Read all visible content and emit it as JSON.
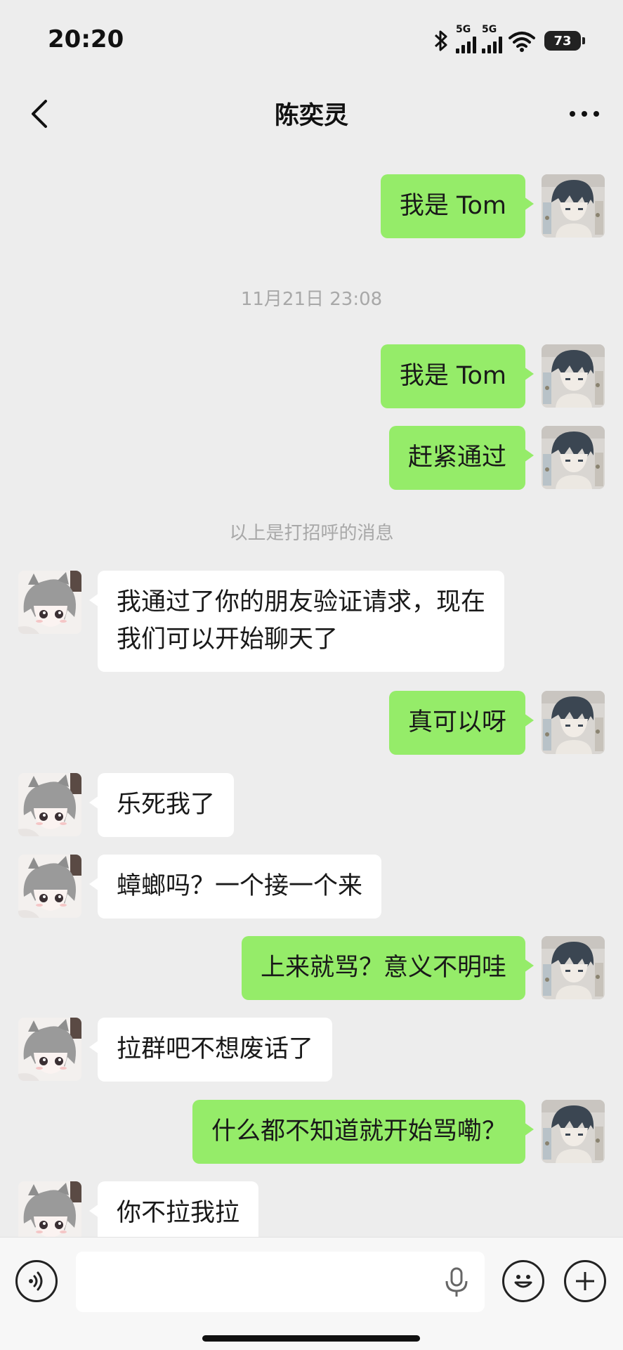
{
  "status_bar": {
    "time": "20:20",
    "net1": "5G",
    "net2": "5G",
    "battery": "73"
  },
  "nav": {
    "title": "陈奕灵"
  },
  "system": {
    "timestamp": "11月21日 23:08",
    "greeting_note": "以上是打招呼的消息"
  },
  "messages": [
    {
      "from": "me",
      "text": "我是 Tom"
    },
    {
      "from": "me",
      "text": "我是 Tom"
    },
    {
      "from": "me",
      "text": "赶紧通过"
    },
    {
      "from": "other",
      "text": "我通过了你的朋友验证请求，现在\n我们可以开始聊天了"
    },
    {
      "from": "me",
      "text": "真可以呀"
    },
    {
      "from": "other",
      "text": "乐死我了"
    },
    {
      "from": "other",
      "text": "蟑螂吗？一个接一个来"
    },
    {
      "from": "me",
      "text": "上来就骂？意义不明哇"
    },
    {
      "from": "other",
      "text": "拉群吧不想废话了"
    },
    {
      "from": "me",
      "text": "什么都不知道就开始骂嘞？"
    },
    {
      "from": "other",
      "text": "你不拉我拉"
    }
  ],
  "colors": {
    "background": "#ededed",
    "my_bubble": "#95ec69",
    "other_bubble": "#ffffff",
    "system_text": "#a8a8a8"
  },
  "icons": [
    "back-arrow-icon",
    "more-icon",
    "voice-icon",
    "mic-icon",
    "emoji-icon",
    "plus-icon",
    "bluetooth-icon",
    "wifi-icon",
    "battery-icon"
  ]
}
